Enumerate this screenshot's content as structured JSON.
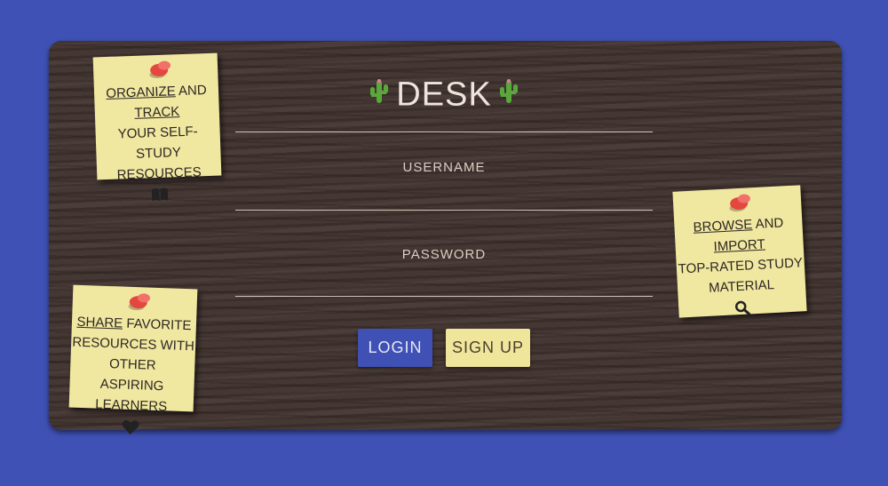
{
  "app": {
    "title": "DESK"
  },
  "login_form": {
    "username_label": "USERNAME",
    "password_label": "PASSWORD",
    "login_button": "LOGIN",
    "signup_button": "SIGN UP"
  },
  "notes": {
    "organize": {
      "w1": "ORGANIZE",
      "w2": " AND ",
      "w3": "TRACK",
      "line2": "YOUR SELF-STUDY",
      "line3": "RESOURCES",
      "icon": "book-icon"
    },
    "browse": {
      "w1": "BROWSE",
      "w2": " AND ",
      "w3": "IMPORT",
      "line2": "TOP-RATED STUDY",
      "line3": "MATERIAL",
      "icon": "search-icon"
    },
    "share": {
      "w1": "SHARE",
      "w2": " FAVORITE",
      "line2": "RESOURCES WITH OTHER",
      "line3": "ASPIRING LEARNERS",
      "icon": "heart-icon"
    }
  },
  "colors": {
    "background": "#3f51b5",
    "board": "#41332f",
    "note": "#f0e7a0",
    "accent_button": "#3f51b5",
    "pin": "#e4473d"
  }
}
